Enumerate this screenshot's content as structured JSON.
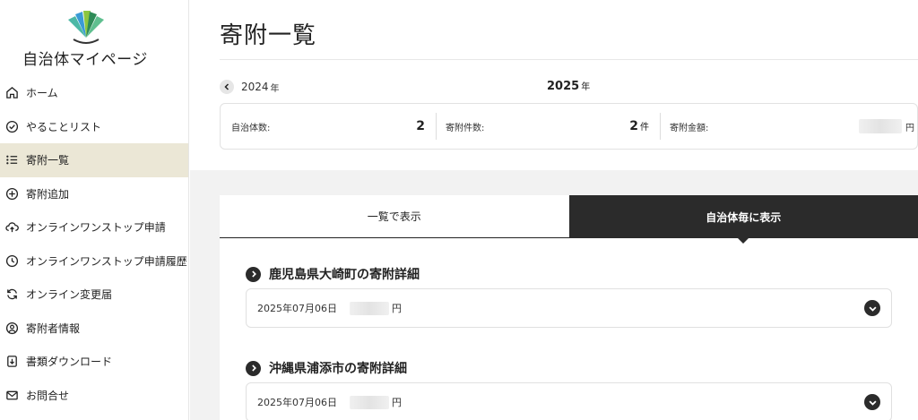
{
  "brand": {
    "name": "自治体マイページ"
  },
  "sidebar": {
    "items": [
      {
        "label": "ホーム",
        "icon": "home-icon"
      },
      {
        "label": "やることリスト",
        "icon": "check-circle-icon"
      },
      {
        "label": "寄附一覧",
        "icon": "list-icon",
        "active": true
      },
      {
        "label": "寄附追加",
        "icon": "plus-circle-icon"
      },
      {
        "label": "オンラインワンストップ申請",
        "icon": "cloud-upload-icon"
      },
      {
        "label": "オンラインワンストップ申請履歴",
        "icon": "clock-icon"
      },
      {
        "label": "オンライン変更届",
        "icon": "refresh-icon"
      },
      {
        "label": "寄附者情報",
        "icon": "user-circle-icon"
      },
      {
        "label": "書類ダウンロード",
        "icon": "download-icon"
      },
      {
        "label": "お問合せ",
        "icon": "mail-icon"
      }
    ]
  },
  "page": {
    "title": "寄附一覧"
  },
  "year_nav": {
    "prev_year": "2024",
    "current_year": "2025",
    "unit": "年"
  },
  "summary": {
    "municipalities_label": "自治体数:",
    "municipalities_value": "2",
    "donations_label": "寄附件数:",
    "donations_value": "2",
    "donations_unit": "件",
    "amount_label": "寄附金額:",
    "amount_unit": "円"
  },
  "tabs": {
    "list_view": "一覧で表示",
    "by_municipality": "自治体毎に表示"
  },
  "groups": [
    {
      "title": "鹿児島県大崎町の寄附詳細",
      "date": "2025年07月06日",
      "currency": "円"
    },
    {
      "title": "沖縄県浦添市の寄附詳細",
      "date": "2025年07月06日",
      "currency": "円"
    }
  ],
  "colors": {
    "active_nav_bg": "#ebe7d6",
    "dark": "#2b2b2b",
    "gray_bg": "#f2f2f2"
  }
}
